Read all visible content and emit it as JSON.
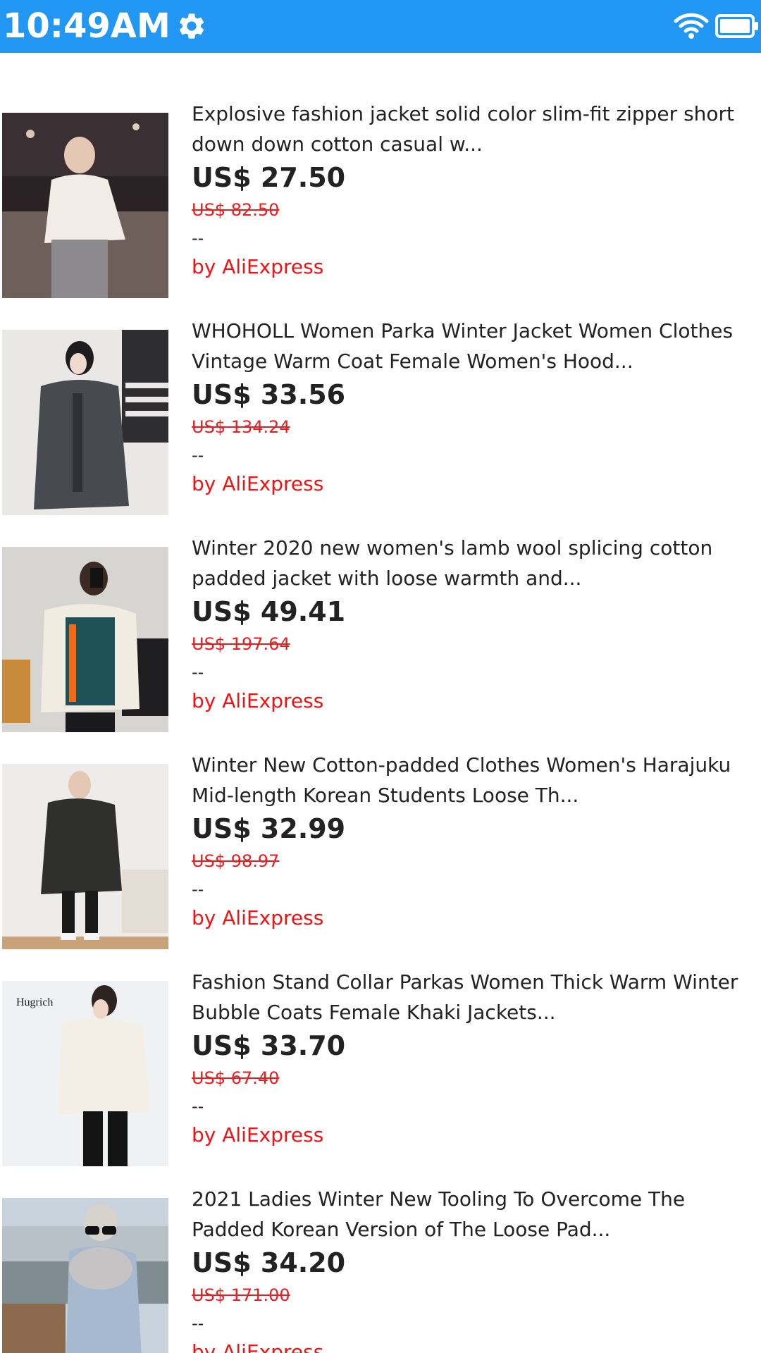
{
  "status_bar": {
    "time": "10:49AM",
    "background": "#2196F3",
    "icons": [
      "gear-icon",
      "wifi-icon",
      "battery-icon"
    ]
  },
  "products": [
    {
      "title": "Explosive fashion jacket solid color slim-fit zipper short down down cotton casual w...",
      "price": "US$ 27.50",
      "original_price": "US$ 82.50",
      "placeholder": "--",
      "seller": "by AliExpress"
    },
    {
      "title": "WHOHOLL Women Parka Winter Jacket Women Clothes Vintage Warm Coat Female Women's Hood...",
      "price": "US$ 33.56",
      "original_price": "US$ 134.24",
      "placeholder": "--",
      "seller": "by AliExpress"
    },
    {
      "title": "Winter 2020 new women's lamb wool splicing cotton padded jacket with loose warmth and...",
      "price": "US$ 49.41",
      "original_price": "US$ 197.64",
      "placeholder": "--",
      "seller": "by AliExpress"
    },
    {
      "title": "Winter New Cotton-padded Clothes Women's Harajuku Mid-length Korean Students Loose Th...",
      "price": "US$ 32.99",
      "original_price": "US$ 98.97",
      "placeholder": "--",
      "seller": "by AliExpress"
    },
    {
      "title": "Fashion Stand Collar Parkas Women Thick Warm Winter Bubble Coats Female Khaki Jackets...",
      "price": "US$ 33.70",
      "original_price": "US$ 67.40",
      "placeholder": "--",
      "seller": "by AliExpress",
      "image_watermark": "Hugrich"
    },
    {
      "title": "2021 Ladies Winter New Tooling To Overcome The Padded Korean Version of The Loose Pad...",
      "price": "US$ 34.20",
      "original_price": "US$ 171.00",
      "placeholder": "--",
      "seller": "by AliExpress"
    }
  ],
  "colors": {
    "accent": "#2196F3",
    "price_strike": "#e62020",
    "seller": "#f21212"
  }
}
